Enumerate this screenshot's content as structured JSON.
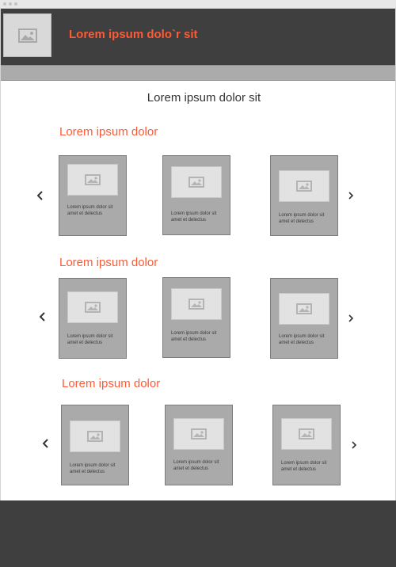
{
  "colors": {
    "accent": "#ff5a36",
    "header_bg": "#3f3f3f",
    "nav_bg": "#ababab",
    "card_bg": "#aaaaaa",
    "thumb_bg": "#e2e2e2"
  },
  "header": {
    "logo_icon": "image-icon",
    "title": "Lorem ipsum dolo`r sit"
  },
  "main": {
    "title": "Lorem ipsum dolor sit"
  },
  "sections": [
    {
      "title": "Lorem ipsum dolor",
      "prev_icon": "chevron-left-icon",
      "next_icon": "chevron-right-icon",
      "cards": [
        {
          "thumb_icon": "image-icon",
          "caption": "Lorem ipsum dolor sit amet et delectus"
        },
        {
          "thumb_icon": "image-icon",
          "caption": "Lorem ipsum dolor sit amet et delectus"
        },
        {
          "thumb_icon": "image-icon",
          "caption": "Lorem ipsum dolor sit amet et delectus"
        }
      ]
    },
    {
      "title": "Lorem ipsum dolor",
      "prev_icon": "chevron-left-icon",
      "next_icon": "chevron-right-icon",
      "cards": [
        {
          "thumb_icon": "image-icon",
          "caption": "Lorem ipsum dolor sit amet et delectus"
        },
        {
          "thumb_icon": "image-icon",
          "caption": "Lorem ipsum dolor sit amet et delectus"
        },
        {
          "thumb_icon": "image-icon",
          "caption": "Lorem ipsum dolor sit amet et delectus"
        }
      ]
    },
    {
      "title": "Lorem ipsum dolor",
      "prev_icon": "chevron-left-icon",
      "next_icon": "chevron-right-icon",
      "cards": [
        {
          "thumb_icon": "image-icon",
          "caption": "Lorem ipsum dolor sit amet et delectus"
        },
        {
          "thumb_icon": "image-icon",
          "caption": "Lorem ipsum dolor sit amet et delectus"
        },
        {
          "thumb_icon": "image-icon",
          "caption": "Lorem ipsum dolor sit amet et delectus"
        }
      ]
    }
  ]
}
